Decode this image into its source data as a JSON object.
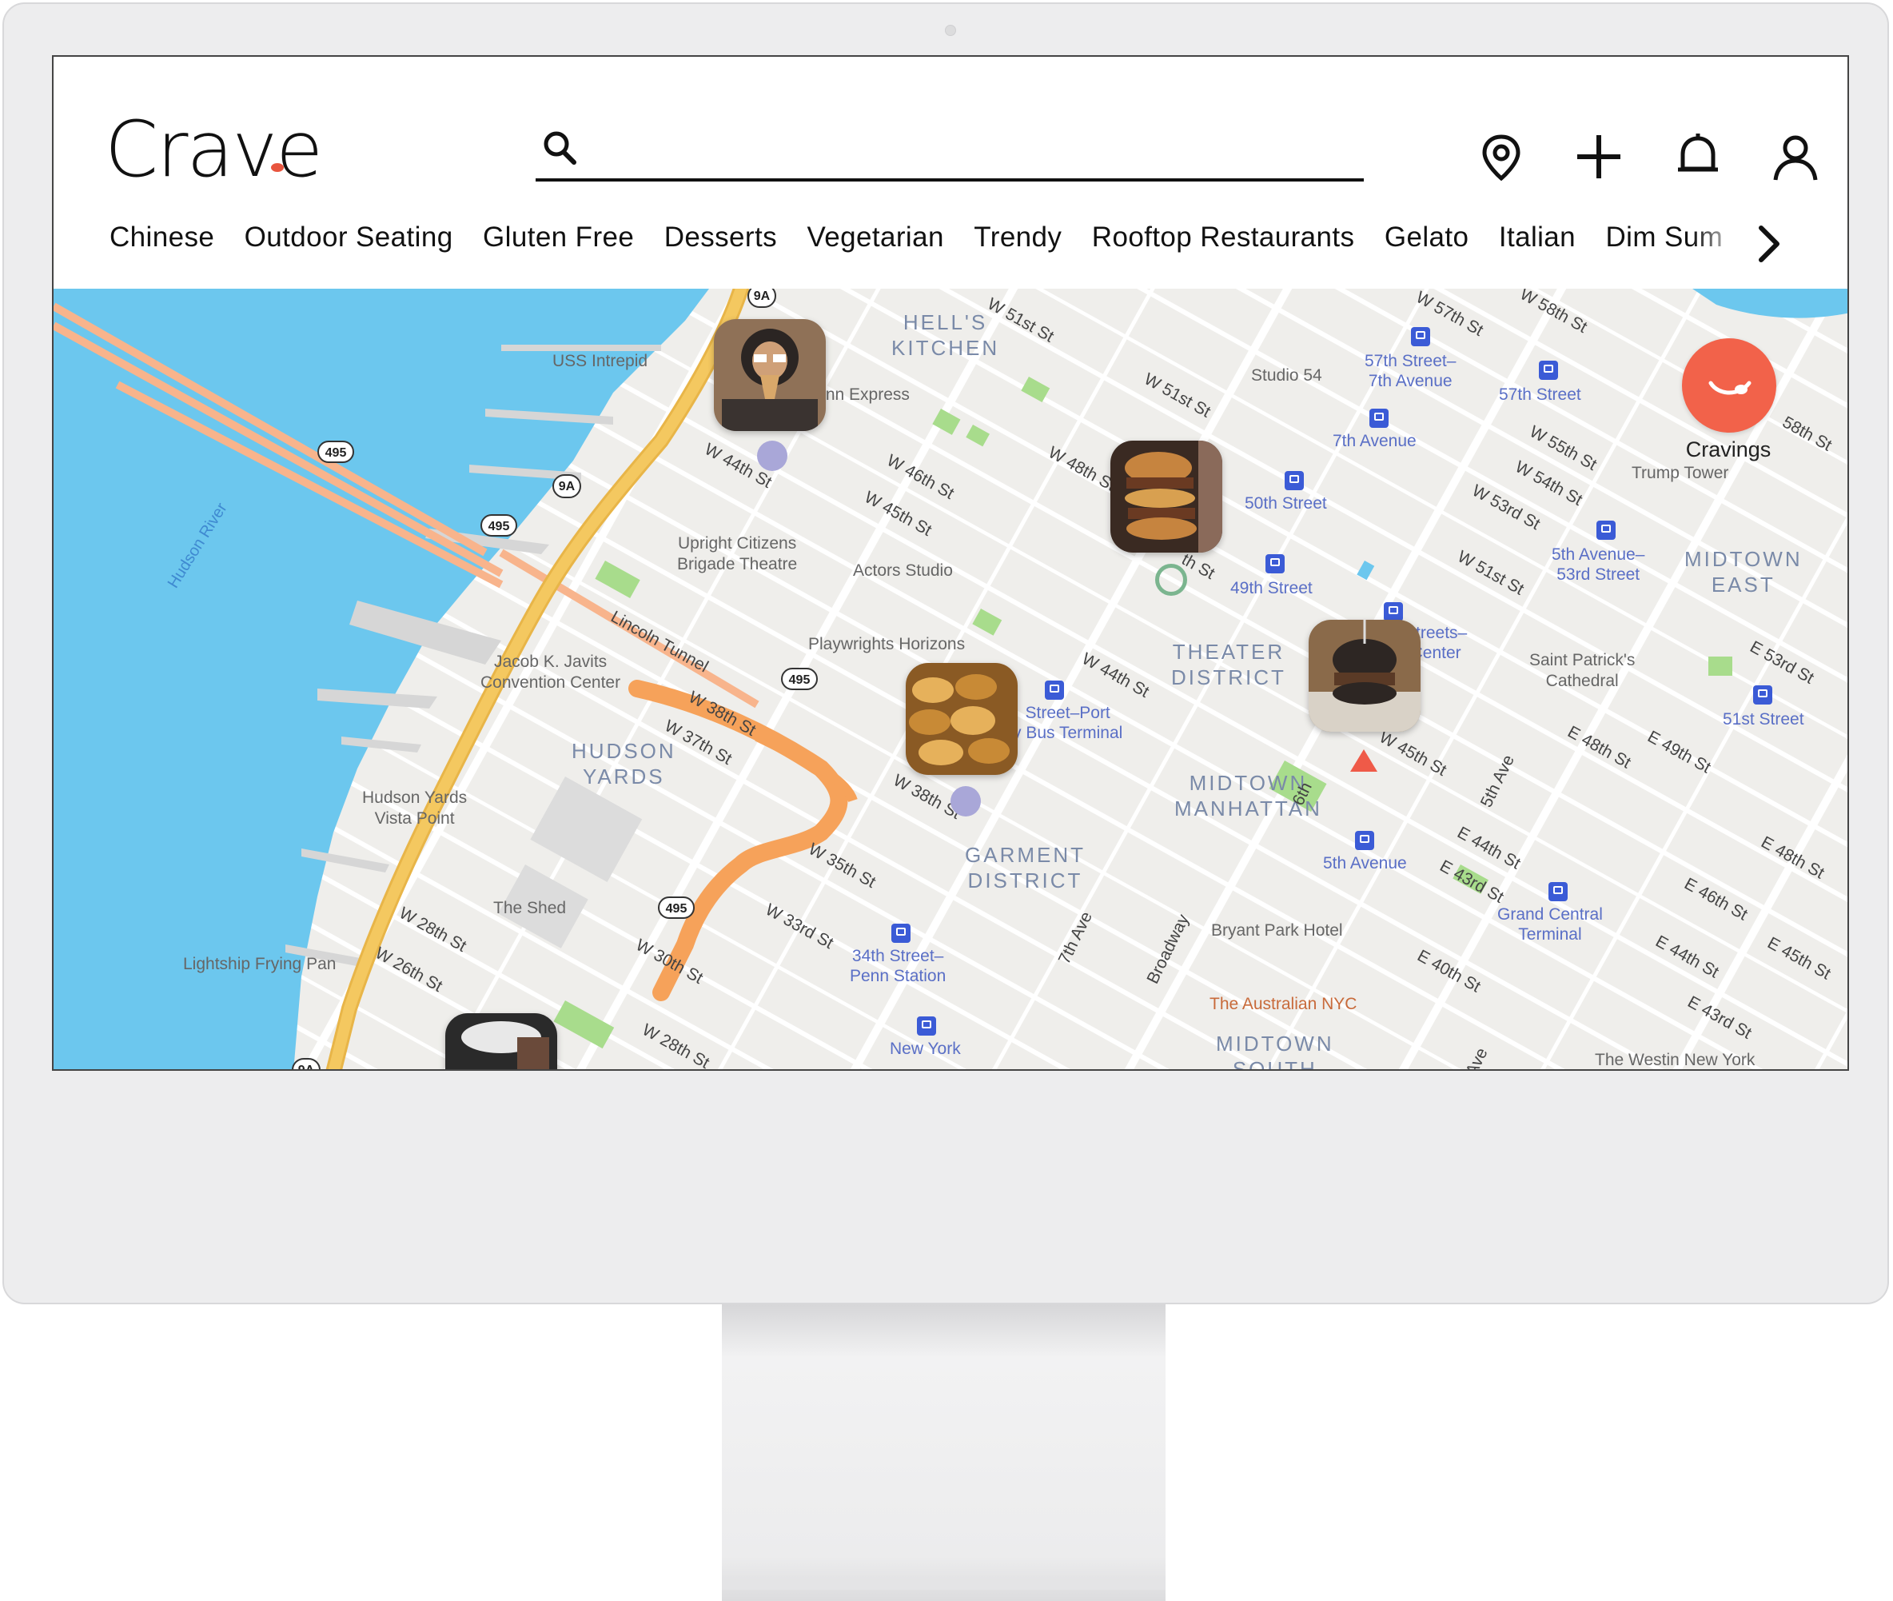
{
  "app": {
    "logo_text": "Crave"
  },
  "search": {
    "placeholder": "",
    "value": ""
  },
  "header": {
    "icons": [
      "location-pin-icon",
      "plus-icon",
      "bell-icon",
      "user-icon"
    ]
  },
  "categories": [
    "Chinese",
    "Outdoor Seating",
    "Gluten Free",
    "Desserts",
    "Vegetarian",
    "Trendy",
    "Rooftop Restaurants",
    "Gelato",
    "Italian",
    "Dim Sum"
  ],
  "cravings_button": {
    "label": "Cravings",
    "color": "#f2624a"
  },
  "map": {
    "districts": {
      "hells_kitchen": "HELL'S\nKITCHEN",
      "theater": "THEATER\nDISTRICT",
      "hudson_yards": "HUDSON\nYARDS",
      "midtown_manhattan": "MIDTOWN\nMANHATTAN",
      "garment": "GARMENT\nDISTRICT",
      "midtown_east": "MIDTOWN\nEAST",
      "midtown_south": "MIDTOWN\nSOUTH"
    },
    "pois": {
      "intrepid": "USS Intrepid",
      "inn_express": "Inn Express",
      "upright": "Upright Citizens\nBrigade Theatre",
      "actors": "Actors Studio",
      "playwrights": "Playwrights Horizons",
      "javits": "Jacob K. Javits\nConvention Center",
      "hy_vista": "Hudson Yards\nVista Point",
      "shed": "The Shed",
      "lightship": "Lightship Frying Pan",
      "studio54": "Studio 54",
      "trump": "Trump Tower",
      "patricks": "Saint Patrick's\nCathedral",
      "bryant": "Bryant Park Hotel",
      "australian": "The Australian NYC",
      "westin": "The Westin New York"
    },
    "stations": {
      "s57_7": "57th Street–\n7th Avenue",
      "s57": "57th Street",
      "s7av": "7th Avenue",
      "s50": "50th Street",
      "s49": "49th Street",
      "s5av53": "5th Avenue–\n53rd Street",
      "s51": "51st Street",
      "s47": "Streets–\nCenter",
      "pabt": "Street–Port\ny Bus Terminal",
      "s5av": "5th Avenue",
      "gct": "Grand Central\nTerminal",
      "penn": "34th Street–\nPenn Station",
      "ny": "New York"
    },
    "streets": {
      "w51": "W 51st St",
      "w57": "W 57th St",
      "w58": "W 58th St",
      "w51b": "W 51st St",
      "w55": "W 55th St",
      "w54": "W 54th St",
      "w53": "W 53rd St",
      "w51c": "W 51st St",
      "w44": "W 44th St",
      "w46": "W 46th St",
      "w45": "W 45th St",
      "w48": "W 48th St",
      "w47": "th St",
      "w44b": "W 44th St",
      "lincoln": "Lincoln Tunnel",
      "w38": "W 38th St",
      "w37": "W 37th St",
      "w38b": "W 38th St",
      "w45b": "W 45th St",
      "w35": "W 35th St",
      "w33": "W 33rd St",
      "w30": "W 30th St",
      "w28": "W 28th St",
      "w26": "W 26th St",
      "w28b": "W 28th St",
      "e53": "E 53rd St",
      "e48": "E 48th St",
      "e49": "E 49th St",
      "e44": "E 44th St",
      "e43": "E 43rd St",
      "e48b": "E 48th St",
      "e46": "E 46th St",
      "e44b": "E 44th St",
      "e45": "E 45th St",
      "e40": "E 40th St",
      "e43b": "E 43rd St",
      "s7av": "7th Ave",
      "broadway": "Broadway",
      "s6th": "6th",
      "s5av": "5th Ave",
      "sk": "k Ave",
      "s58": "58th St",
      "hudson": "Hudson River"
    },
    "shields": [
      "9A",
      "495",
      "9A",
      "495",
      "495",
      "495",
      "9A"
    ],
    "pins": [
      {
        "name": "ice-cream-person",
        "colors": [
          "#8f7157",
          "#2b2523",
          "#cfa078"
        ]
      },
      {
        "name": "stacked-burger",
        "colors": [
          "#6a3a22",
          "#c6843f",
          "#3a2a22"
        ]
      },
      {
        "name": "black-bun-burger",
        "colors": [
          "#2d2623",
          "#8a6a4a",
          "#d9d2c7"
        ]
      },
      {
        "name": "pastries",
        "colors": [
          "#c88a36",
          "#e6b15b",
          "#8a5a24"
        ]
      },
      {
        "name": "partial-drink",
        "colors": [
          "#2a2a2a",
          "#e8e8e8",
          "#6a4a3a"
        ]
      }
    ]
  },
  "colors": {
    "accent": "#f2624a",
    "water": "#6cc7ee",
    "highway": "#f4c860",
    "park": "#a8dc8c",
    "metro": "#3b5bd6",
    "route": "#f6a25a"
  }
}
